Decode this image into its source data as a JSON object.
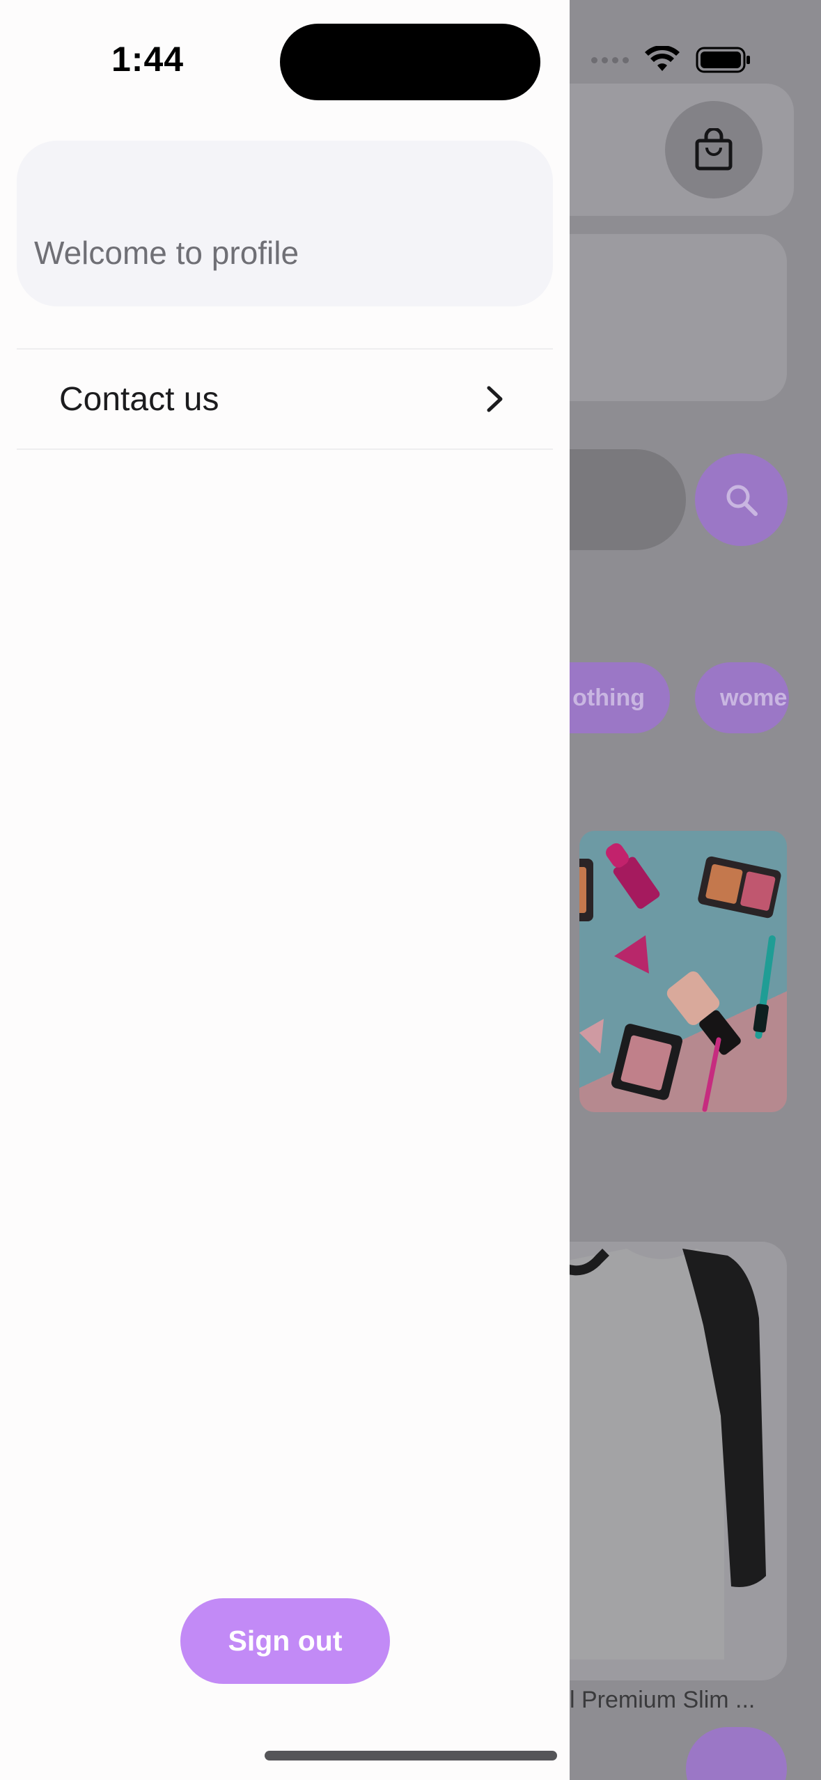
{
  "status_bar": {
    "time": "1:44"
  },
  "drawer": {
    "profile": {
      "welcome_text": "Welcome to profile"
    },
    "menu_items": [
      {
        "label": "Contact us",
        "icon": "chevron-right-icon"
      }
    ],
    "sign_out_label": "Sign out"
  },
  "background_app": {
    "category_chips": [
      "othing",
      "wome"
    ],
    "product_title": "l Premium Slim ...",
    "icons": [
      "shopping-bag-icon",
      "search-icon"
    ]
  },
  "colors": {
    "accent": "#c28af6",
    "drawer_bg": "#fdfcfc",
    "card_bg": "#f4f4f8",
    "overlay": "#8e8d92"
  }
}
